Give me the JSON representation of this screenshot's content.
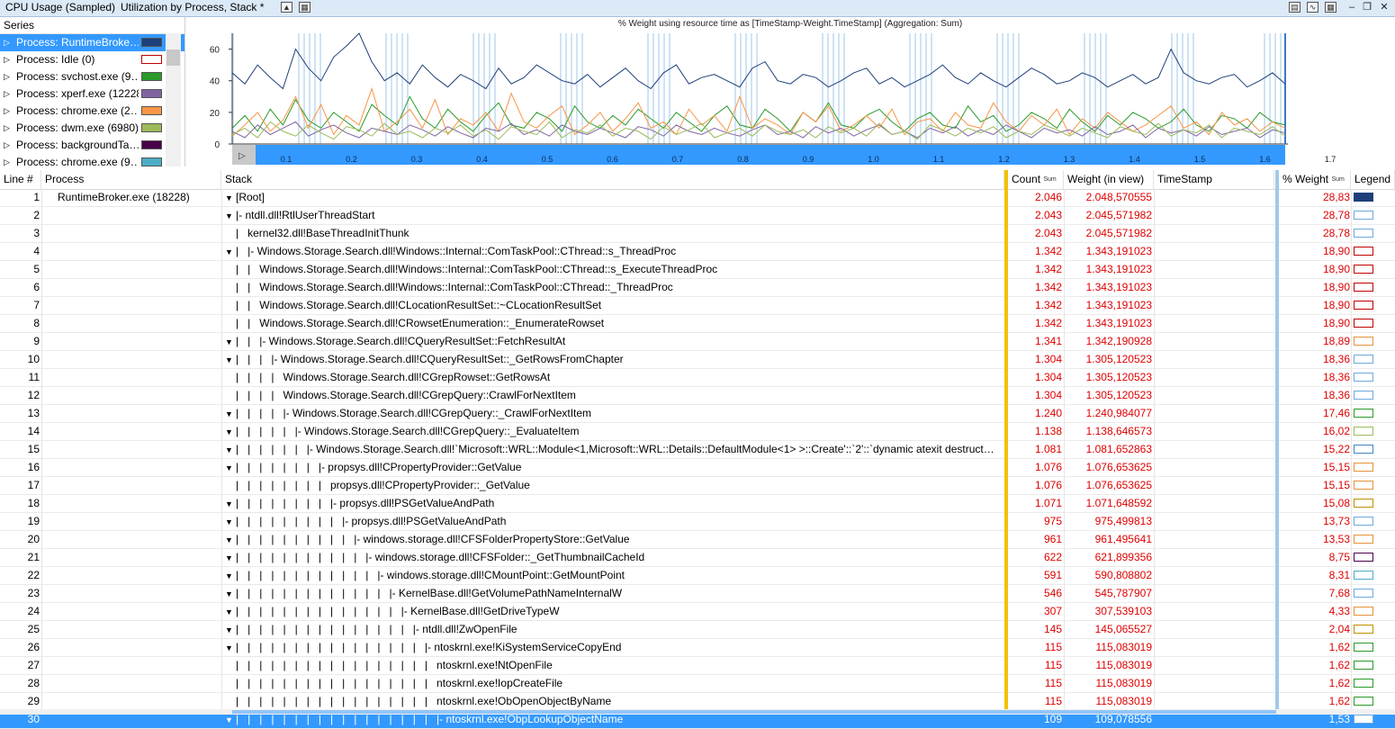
{
  "titlebar": {
    "graph_name": "CPU Usage (Sampled)",
    "preset_name": "Utilization by Process, Stack *"
  },
  "series_panel": {
    "header": "Series",
    "items": [
      {
        "label": "Process: RuntimeBroke…",
        "color": "#1f3f7a",
        "selected": true
      },
      {
        "label": "Process: Idle (0)",
        "color": "#ffffff",
        "border": "#c00000"
      },
      {
        "label": "Process: svchost.exe (9…",
        "color": "#2a9a2a"
      },
      {
        "label": "Process: xperf.exe (12228)",
        "color": "#8064a2"
      },
      {
        "label": "Process: chrome.exe (2…",
        "color": "#f79646"
      },
      {
        "label": "Process: dwm.exe (6980)",
        "color": "#9bbb59"
      },
      {
        "label": "Process: backgroundTa…",
        "color": "#4a004a"
      },
      {
        "label": "Process: chrome.exe (9…",
        "color": "#4bacc6"
      }
    ]
  },
  "chart_data": {
    "type": "line",
    "title": "% Weight using resource time as [TimeStamp-Weight.TimeStamp] (Aggregation: Sum)",
    "ylim": [
      0,
      70
    ],
    "yticks": [
      "0",
      "20",
      "40",
      "60"
    ],
    "xticks": [
      "0.1",
      "0.2",
      "0.3",
      "0.4",
      "0.5",
      "0.6",
      "0.7",
      "0.8",
      "0.9",
      "1.0",
      "1.1",
      "1.2",
      "1.3",
      "1.4",
      "1.5",
      "1.6",
      "1.7"
    ],
    "series": [
      {
        "name": "Process: RuntimeBroke…",
        "color": "#1f3f7a",
        "values": [
          45,
          38,
          50,
          42,
          35,
          60,
          48,
          40,
          55,
          62,
          70,
          52,
          40,
          45,
          38,
          50,
          42,
          36,
          44,
          40,
          35,
          48,
          38,
          42,
          50,
          45,
          40,
          38,
          44,
          36,
          42,
          48,
          40,
          35,
          45,
          50,
          38,
          42,
          44,
          40,
          36,
          48,
          52,
          40,
          38,
          44,
          42,
          36,
          40,
          45,
          48,
          38,
          42,
          36,
          40,
          44,
          50,
          42,
          38,
          45,
          40,
          36,
          42,
          48,
          44,
          38,
          40,
          45,
          42,
          36,
          40,
          44,
          38,
          42,
          60,
          45,
          40,
          38,
          42,
          44,
          36,
          40,
          45,
          38
        ]
      },
      {
        "name": "Process: svchost.exe (9…",
        "color": "#2a9a2a",
        "values": [
          10,
          18,
          8,
          22,
          12,
          28,
          15,
          10,
          20,
          14,
          8,
          25,
          18,
          12,
          30,
          16,
          10,
          22,
          14,
          8,
          18,
          26,
          12,
          10,
          20,
          16,
          8,
          24,
          14,
          10,
          18,
          12,
          22,
          16,
          10,
          20,
          14,
          8,
          18,
          24,
          12,
          10,
          22,
          16,
          8,
          20,
          14,
          26,
          12,
          10,
          18,
          22,
          14,
          8,
          16,
          20,
          12,
          10,
          24,
          14,
          18,
          8,
          12,
          20,
          16,
          10,
          22,
          14,
          8,
          18,
          12,
          20,
          16,
          10,
          14,
          22,
          12,
          8,
          18,
          16,
          10,
          20,
          14,
          12
        ]
      },
      {
        "name": "Process: chrome.exe (2…",
        "color": "#f79646",
        "values": [
          5,
          12,
          20,
          8,
          15,
          30,
          10,
          25,
          6,
          18,
          12,
          35,
          8,
          14,
          22,
          10,
          28,
          6,
          16,
          12,
          20,
          8,
          32,
          14,
          10,
          18,
          24,
          6,
          12,
          20,
          8,
          16,
          26,
          10,
          14,
          6,
          22,
          12,
          18,
          8,
          30,
          10,
          16,
          12,
          6,
          20,
          14,
          24,
          8,
          12,
          18,
          10,
          22,
          6,
          14,
          16,
          8,
          20,
          12,
          10,
          26,
          14,
          8,
          18,
          12,
          22,
          6,
          16,
          10,
          20,
          14,
          8,
          12,
          18,
          24,
          10,
          14,
          6,
          20,
          12,
          16,
          8,
          14,
          10
        ]
      },
      {
        "name": "Process: xperf.exe (12228)",
        "color": "#8064a2",
        "values": [
          8,
          4,
          12,
          6,
          10,
          14,
          5,
          9,
          12,
          7,
          4,
          10,
          8,
          6,
          12,
          9,
          5,
          11,
          7,
          4,
          10,
          8,
          13,
          6,
          9,
          5,
          12,
          8,
          6,
          10,
          7,
          4,
          11,
          9,
          5,
          12,
          8,
          6,
          10,
          7,
          5,
          9,
          12,
          6,
          8,
          4,
          11,
          7,
          10,
          5,
          9,
          12,
          6,
          8,
          4,
          10,
          7,
          11,
          5,
          9,
          6,
          12,
          8,
          4,
          10,
          7,
          9,
          5,
          11,
          6,
          8,
          12,
          4,
          10,
          7,
          9,
          5,
          11,
          6,
          8,
          10,
          4,
          9,
          7
        ]
      },
      {
        "name": "Process: dwm.exe (6980)",
        "color": "#9bbb59",
        "values": [
          6,
          10,
          4,
          14,
          8,
          5,
          12,
          7,
          3,
          11,
          9,
          5,
          13,
          6,
          8,
          4,
          10,
          7,
          12,
          5,
          9,
          3,
          11,
          8,
          6,
          14,
          4,
          9,
          7,
          12,
          5,
          10,
          8,
          3,
          11,
          6,
          9,
          13,
          4,
          7,
          10,
          5,
          12,
          8,
          6,
          9,
          4,
          11,
          7,
          10,
          5,
          13,
          6,
          8,
          3,
          12,
          9,
          5,
          10,
          7,
          11,
          4,
          8,
          6,
          12,
          9,
          5,
          10,
          7,
          4,
          11,
          8,
          6,
          13,
          5,
          9,
          7,
          12,
          4,
          10,
          8,
          6,
          11,
          5
        ]
      }
    ]
  },
  "table": {
    "columns": {
      "line": "Line #",
      "process": "Process",
      "stack": "Stack",
      "count": "Count",
      "count_sub": "Sum",
      "weight": "Weight (in view)",
      "timestamp": "TimeStamp",
      "pct_weight": "% Weight",
      "pct_sub": "Sum",
      "legend": "Legend"
    },
    "rows": [
      {
        "line": "1",
        "process": "RuntimeBroker.exe (18228)",
        "exp": "▼",
        "stack": "[Root]",
        "count": "2.046",
        "weight": "2.048,570555",
        "pct": "28,83",
        "leg": "#1f3f7a",
        "legfill": true
      },
      {
        "line": "2",
        "process": "",
        "exp": "▼",
        "stack": "|- ntdll.dll!RtlUserThreadStart",
        "count": "2.043",
        "weight": "2.045,571982",
        "pct": "28,78",
        "leg": "#6fa8dc"
      },
      {
        "line": "3",
        "process": "",
        "exp": "",
        "stack": "|   kernel32.dll!BaseThreadInitThunk",
        "count": "2.043",
        "weight": "2.045,571982",
        "pct": "28,78",
        "leg": "#6fa8dc"
      },
      {
        "line": "4",
        "process": "",
        "exp": "▼",
        "stack": "|   |- Windows.Storage.Search.dll!Windows::Internal::ComTaskPool::CThread::s_ThreadProc",
        "count": "1.342",
        "weight": "1.343,191023",
        "pct": "18,90",
        "leg": "#c00000"
      },
      {
        "line": "5",
        "process": "",
        "exp": "",
        "stack": "|   |   Windows.Storage.Search.dll!Windows::Internal::ComTaskPool::CThread::s_ExecuteThreadProc",
        "count": "1.342",
        "weight": "1.343,191023",
        "pct": "18,90",
        "leg": "#c00000"
      },
      {
        "line": "6",
        "process": "",
        "exp": "",
        "stack": "|   |   Windows.Storage.Search.dll!Windows::Internal::ComTaskPool::CThread::_ThreadProc",
        "count": "1.342",
        "weight": "1.343,191023",
        "pct": "18,90",
        "leg": "#c00000"
      },
      {
        "line": "7",
        "process": "",
        "exp": "",
        "stack": "|   |   Windows.Storage.Search.dll!CLocationResultSet::~CLocationResultSet",
        "count": "1.342",
        "weight": "1.343,191023",
        "pct": "18,90",
        "leg": "#c00000"
      },
      {
        "line": "8",
        "process": "",
        "exp": "",
        "stack": "|   |   Windows.Storage.Search.dll!CRowsetEnumeration::_EnumerateRowset",
        "count": "1.342",
        "weight": "1.343,191023",
        "pct": "18,90",
        "leg": "#c00000"
      },
      {
        "line": "9",
        "process": "",
        "exp": "▼",
        "stack": "|   |   |- Windows.Storage.Search.dll!CQueryResultSet::FetchResultAt",
        "count": "1.341",
        "weight": "1.342,190928",
        "pct": "18,89",
        "leg": "#e69138"
      },
      {
        "line": "10",
        "process": "",
        "exp": "▼",
        "stack": "|   |   |   |- Windows.Storage.Search.dll!CQueryResultSet::_GetRowsFromChapter",
        "count": "1.304",
        "weight": "1.305,120523",
        "pct": "18,36",
        "leg": "#6fa8dc"
      },
      {
        "line": "11",
        "process": "",
        "exp": "",
        "stack": "|   |   |   |   Windows.Storage.Search.dll!CGrepRowset::GetRowsAt",
        "count": "1.304",
        "weight": "1.305,120523",
        "pct": "18,36",
        "leg": "#6fa8dc"
      },
      {
        "line": "12",
        "process": "",
        "exp": "",
        "stack": "|   |   |   |   Windows.Storage.Search.dll!CGrepQuery::CrawlForNextItem",
        "count": "1.304",
        "weight": "1.305,120523",
        "pct": "18,36",
        "leg": "#6fa8dc"
      },
      {
        "line": "13",
        "process": "",
        "exp": "▼",
        "stack": "|   |   |   |   |- Windows.Storage.Search.dll!CGrepQuery::_CrawlForNextItem",
        "count": "1.240",
        "weight": "1.240,984077",
        "pct": "17,46",
        "leg": "#2a9a2a"
      },
      {
        "line": "14",
        "process": "",
        "exp": "▼",
        "stack": "|   |   |   |   |   |- Windows.Storage.Search.dll!CGrepQuery::_EvaluateItem",
        "count": "1.138",
        "weight": "1.138,646573",
        "pct": "16,02",
        "leg": "#9bbb59"
      },
      {
        "line": "15",
        "process": "",
        "exp": "▼",
        "stack": "|   |   |   |   |   |   |- Windows.Storage.Search.dll!`Microsoft::WRL::Module<1,Microsoft::WRL::Details::DefaultModule<1> >::Create'::`2'::`dynamic atexit destruct…",
        "count": "1.081",
        "weight": "1.081,652863",
        "pct": "15,22",
        "leg": "#3d85c6"
      },
      {
        "line": "16",
        "process": "",
        "exp": "▼",
        "stack": "|   |   |   |   |   |   |   |- propsys.dll!CPropertyProvider::GetValue",
        "count": "1.076",
        "weight": "1.076,653625",
        "pct": "15,15",
        "leg": "#e69138"
      },
      {
        "line": "17",
        "process": "",
        "exp": "",
        "stack": "|   |   |   |   |   |   |   |   propsys.dll!CPropertyProvider::_GetValue",
        "count": "1.076",
        "weight": "1.076,653625",
        "pct": "15,15",
        "leg": "#e69138"
      },
      {
        "line": "18",
        "process": "",
        "exp": "▼",
        "stack": "|   |   |   |   |   |   |   |   |- propsys.dll!PSGetValueAndPath",
        "count": "1.071",
        "weight": "1.071,648592",
        "pct": "15,08",
        "leg": "#bf9000"
      },
      {
        "line": "19",
        "process": "",
        "exp": "▼",
        "stack": "|   |   |   |   |   |   |   |   |   |- propsys.dll!PSGetValueAndPath",
        "count": "975",
        "weight": "975,499813",
        "pct": "13,73",
        "leg": "#6fa8dc"
      },
      {
        "line": "20",
        "process": "",
        "exp": "▼",
        "stack": "|   |   |   |   |   |   |   |   |   |   |- windows.storage.dll!CFSFolderPropertyStore::GetValue",
        "count": "961",
        "weight": "961,495641",
        "pct": "13,53",
        "leg": "#e69138"
      },
      {
        "line": "21",
        "process": "",
        "exp": "▼",
        "stack": "|   |   |   |   |   |   |   |   |   |   |   |- windows.storage.dll!CFSFolder::_GetThumbnailCacheId",
        "count": "622",
        "weight": "621,899356",
        "pct": "8,75",
        "leg": "#4a004a"
      },
      {
        "line": "22",
        "process": "",
        "exp": "▼",
        "stack": "|   |   |   |   |   |   |   |   |   |   |   |   |- windows.storage.dll!CMountPoint::GetMountPoint",
        "count": "591",
        "weight": "590,808802",
        "pct": "8,31",
        "leg": "#4bacc6"
      },
      {
        "line": "23",
        "process": "",
        "exp": "▼",
        "stack": "|   |   |   |   |   |   |   |   |   |   |   |   |   |- KernelBase.dll!GetVolumePathNameInternalW",
        "count": "546",
        "weight": "545,787907",
        "pct": "7,68",
        "leg": "#6fa8dc"
      },
      {
        "line": "24",
        "process": "",
        "exp": "▼",
        "stack": "|   |   |   |   |   |   |   |   |   |   |   |   |   |   |- KernelBase.dll!GetDriveTypeW",
        "count": "307",
        "weight": "307,539103",
        "pct": "4,33",
        "leg": "#e69138"
      },
      {
        "line": "25",
        "process": "",
        "exp": "▼",
        "stack": "|   |   |   |   |   |   |   |   |   |   |   |   |   |   |   |- ntdll.dll!ZwOpenFile",
        "count": "145",
        "weight": "145,065527",
        "pct": "2,04",
        "leg": "#bf9000"
      },
      {
        "line": "26",
        "process": "",
        "exp": "▼",
        "stack": "|   |   |   |   |   |   |   |   |   |   |   |   |   |   |   |   |- ntoskrnl.exe!KiSystemServiceCopyEnd",
        "count": "115",
        "weight": "115,083019",
        "pct": "1,62",
        "leg": "#2a9a2a"
      },
      {
        "line": "27",
        "process": "",
        "exp": "",
        "stack": "|   |   |   |   |   |   |   |   |   |   |   |   |   |   |   |   |   ntoskrnl.exe!NtOpenFile",
        "count": "115",
        "weight": "115,083019",
        "pct": "1,62",
        "leg": "#2a9a2a"
      },
      {
        "line": "28",
        "process": "",
        "exp": "",
        "stack": "|   |   |   |   |   |   |   |   |   |   |   |   |   |   |   |   |   ntoskrnl.exe!IopCreateFile",
        "count": "115",
        "weight": "115,083019",
        "pct": "1,62",
        "leg": "#2a9a2a"
      },
      {
        "line": "29",
        "process": "",
        "exp": "",
        "stack": "|   |   |   |   |   |   |   |   |   |   |   |   |   |   |   |   |   ntoskrnl.exe!ObOpenObjectByName",
        "count": "115",
        "weight": "115,083019",
        "pct": "1,62",
        "leg": "#2a9a2a"
      },
      {
        "line": "30",
        "process": "",
        "exp": "▼",
        "stack": "|   |   |   |   |   |   |   |   |   |   |   |   |   |   |   |   |   |- ntoskrnl.exe!ObpLookupObjectName",
        "count": "109",
        "weight": "109,078556",
        "pct": "1,53",
        "leg": "#6fa8dc",
        "selected": true
      }
    ]
  }
}
